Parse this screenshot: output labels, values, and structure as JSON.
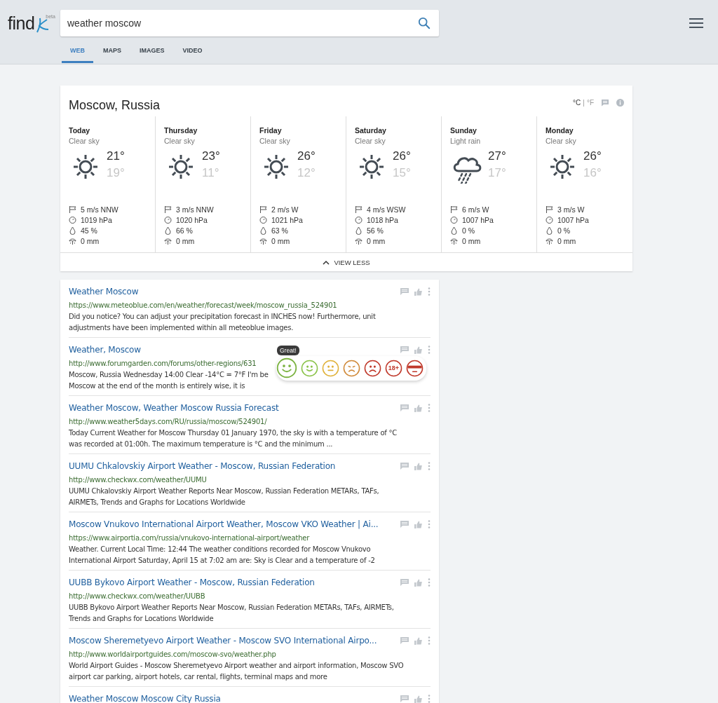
{
  "header": {
    "logo": {
      "text": "find",
      "badge": "beta"
    },
    "search": {
      "value": "weather moscow"
    },
    "tabs": [
      {
        "label": "WEB",
        "selected": true
      },
      {
        "label": "MAPS",
        "selected": false
      },
      {
        "label": "IMAGES",
        "selected": false
      },
      {
        "label": "VIDEO",
        "selected": false
      }
    ]
  },
  "weather": {
    "title": "Moscow, Russia",
    "units": [
      {
        "label": "°C",
        "selected": true
      },
      {
        "label": "°F",
        "selected": false
      }
    ],
    "unit_separator": "|",
    "days": [
      {
        "name": "Today",
        "condition": "Clear sky",
        "kind": "sun",
        "high": "21°",
        "low": "19°",
        "wind": "5 m/s NNW",
        "pressure": "1019 hPa",
        "humidity": "45 %",
        "precipitation": "0 mm"
      },
      {
        "name": "Thursday",
        "condition": "Clear sky",
        "kind": "sun",
        "high": "23°",
        "low": "11°",
        "wind": "3 m/s NNW",
        "pressure": "1020 hPa",
        "humidity": "66 %",
        "precipitation": "0 mm"
      },
      {
        "name": "Friday",
        "condition": "Clear sky",
        "kind": "sun",
        "high": "26°",
        "low": "12°",
        "wind": "2 m/s W",
        "pressure": "1021 hPa",
        "humidity": "63 %",
        "precipitation": "0 mm"
      },
      {
        "name": "Saturday",
        "condition": "Clear sky",
        "kind": "sun",
        "high": "26°",
        "low": "15°",
        "wind": "4 m/s WSW",
        "pressure": "1018 hPa",
        "humidity": "56 %",
        "precipitation": "0 mm"
      },
      {
        "name": "Sunday",
        "condition": "Light rain",
        "kind": "rain",
        "high": "27°",
        "low": "17°",
        "wind": "6 m/s W",
        "pressure": "1007 hPa",
        "humidity": "0 %",
        "precipitation": "0 mm"
      },
      {
        "name": "Monday",
        "condition": "Clear sky",
        "kind": "sun",
        "high": "26°",
        "low": "16°",
        "wind": "3 m/s W",
        "pressure": "1007 hPa",
        "humidity": "0 %",
        "precipitation": "0 mm"
      }
    ],
    "toggle": {
      "label": "VIEW LESS",
      "expanded": true
    }
  },
  "results": [
    {
      "title": "Weather Moscow",
      "url": "https://www.meteoblue.com/en/weather/forecast/week/moscow_russia_524901",
      "description": "Did you notice? You can adjust your precipitation forecast in INCHES now! Furthermore, unit\nadjustments have been implemented within all meteoblue images."
    },
    {
      "title": "Weather, Moscow",
      "url": "http://www.forumgarden.com/forums/other-regions/631",
      "description": "Moscow, Russia Wednesday 14:00 Clear -14°C = 7°F I'm be\nMoscow at the end of the month is entirely wise, it is",
      "reactions": {
        "tooltip": "Great!",
        "items": [
          {
            "kind": "happy",
            "color": "#7cb342",
            "selected": true
          },
          {
            "kind": "smile",
            "color": "#8bc34a",
            "selected": false
          },
          {
            "kind": "neutral",
            "color": "#e0b23a",
            "selected": false
          },
          {
            "kind": "frown",
            "color": "#d08a3a",
            "selected": false
          },
          {
            "kind": "sad",
            "color": "#c0392b",
            "selected": false
          },
          {
            "kind": "adult",
            "color": "#c0392b",
            "selected": false,
            "label": "18+"
          },
          {
            "kind": "masked",
            "color": "#c0392b",
            "selected": false
          }
        ]
      }
    },
    {
      "title": "Weather Moscow, Weather Moscow Russia Forecast",
      "url": "http://www.weather5days.com/RU/russia/moscow/524901/",
      "description": "Today Current Weather for Moscow Thursday 01 January 1970, the sky is with a temperature of °C\nwas recorded at 01:00h. The maximum temperature is °C and the minimum ..."
    },
    {
      "title": "UUMU Chkalovskiy Airport Weather - Moscow, Russian Federation",
      "url": "http://www.checkwx.com/weather/UUMU",
      "description": "UUMU Chkalovskiy Airport Weather Reports Near Moscow, Russian Federation METARs, TAFs,\nAIRMETs, Trends and Graphs for Locations Worldwide"
    },
    {
      "title": "Moscow Vnukovo International Airport Weather, Moscow VKO Weather | Ai...",
      "url": "https://www.airportia.com/russia/vnukovo-international-airport/weather",
      "description": "Weather. Current Local Time: 12:44 The weather conditions recorded for Moscow Vnukovo\nInternational Airport Saturday, April 15 at 7:02 am are: Sky is Clear and a temperature of -2"
    },
    {
      "title": "UUBB Bykovo Airport Weather - Moscow, Russian Federation",
      "url": "http://www.checkwx.com/weather/UUBB",
      "description": "UUBB Bykovo Airport Weather Reports Near Moscow, Russian Federation METARs, TAFs, AIRMETs,\nTrends and Graphs for Locations Worldwide"
    },
    {
      "title": "Moscow Sheremetyevo Airport Weather - Moscow SVO International Airpo...",
      "url": "http://www.worldairportguides.com/moscow-svo/weather.php",
      "description": "World Airport Guides - Moscow Sheremetyevo Airport weather and airport information, Moscow SVO\nairport car parking, airport hotels, car rental, flights, terminal maps and more"
    },
    {
      "title": "Weather Moscow Moscow City Russia"
    }
  ]
}
